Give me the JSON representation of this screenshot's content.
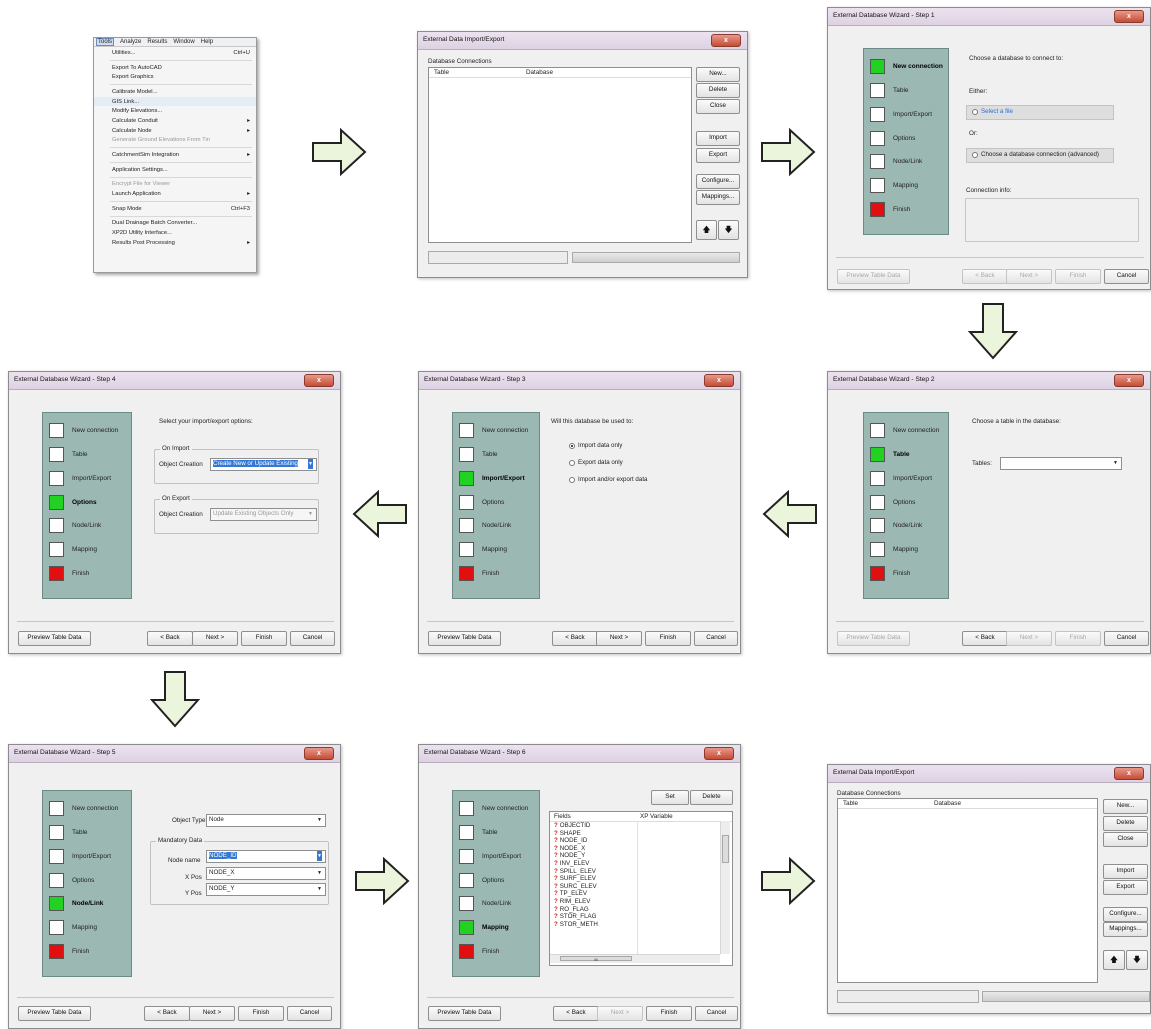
{
  "menu": {
    "bar": [
      "Tools",
      "Analyze",
      "Results",
      "Window",
      "Help"
    ],
    "items": [
      {
        "label": "Utilities...",
        "shortcut": "Ctrl+U"
      },
      {
        "sep": true
      },
      {
        "label": "Export To AutoCAD"
      },
      {
        "label": "Export Graphics"
      },
      {
        "sep": true
      },
      {
        "label": "Calibrate Model..."
      },
      {
        "label": "GIS Link...",
        "hot": true
      },
      {
        "label": "Modify Elevations..."
      },
      {
        "label": "Calculate Conduit",
        "sub": true
      },
      {
        "label": "Calculate Node",
        "sub": true
      },
      {
        "label": "Generate Ground Elevations From Tin",
        "disabled": true
      },
      {
        "sep": true
      },
      {
        "label": "CatchmentSim Integration",
        "sub": true
      },
      {
        "sep": true
      },
      {
        "label": "Application Settings..."
      },
      {
        "sep": true
      },
      {
        "label": "Encrypt File for Viewer",
        "disabled": true
      },
      {
        "label": "Launch Application",
        "sub": true
      },
      {
        "sep": true
      },
      {
        "label": "Snap Mode",
        "shortcut": "Ctrl+F3"
      },
      {
        "sep": true
      },
      {
        "label": "Dual Drainage Batch Converter..."
      },
      {
        "label": "XP2D Utility Interface..."
      },
      {
        "label": "Results Post Processing",
        "sub": true
      }
    ]
  },
  "import_export": {
    "title": "External Data Import/Export",
    "group_label": "Database Connections",
    "col_table": "Table",
    "col_database": "Database",
    "buttons": {
      "new": "New...",
      "delete": "Delete",
      "close": "Close",
      "import": "Import",
      "export": "Export",
      "configure": "Configure...",
      "mappings": "Mappings...",
      "up": "🡅",
      "down": "🡇"
    }
  },
  "wizard": {
    "steps": [
      "New connection",
      "Table",
      "Import/Export",
      "Options",
      "Node/Link",
      "Mapping",
      "Finish"
    ],
    "buttons": {
      "preview": "Preview Table Data",
      "back": "< Back",
      "next": "Next >",
      "finish": "Finish",
      "cancel": "Cancel"
    },
    "step1": {
      "title": "External Database Wizard - Step 1",
      "prompt": "Choose a database to connect to:",
      "either": "Either:",
      "select_file": "Select a file",
      "or": "Or:",
      "choose_conn": "Choose a database connection (advanced)",
      "conn_info": "Connection info:"
    },
    "step2": {
      "title": "External Database Wizard - Step 2",
      "prompt": "Choose a table in the database:",
      "tables_label": "Tables:"
    },
    "step3": {
      "title": "External Database Wizard - Step 3",
      "prompt": "Will this database be used to:",
      "opt1": "Import data only",
      "opt2": "Export data only",
      "opt3": "Import and/or export data"
    },
    "step4": {
      "title": "External Database Wizard - Step 4",
      "prompt": "Select your import/export options:",
      "on_import": "On Import",
      "on_export": "On Export",
      "object_creation": "Object Creation",
      "import_value": "Create New or Update Existing",
      "export_value": "Update Existing Objects Only"
    },
    "step5": {
      "title": "External Database Wizard - Step 5",
      "object_type_label": "Object Type",
      "object_type_value": "Node",
      "mandatory": "Mandatory Data",
      "node_name_label": "Node name",
      "node_name_value": "NODE_ID",
      "xpos_label": "X Pos",
      "xpos_value": "NODE_X",
      "ypos_label": "Y Pos",
      "ypos_value": "NODE_Y"
    },
    "step6": {
      "title": "External Database Wizard - Step 6",
      "set": "Set",
      "delete": "Delete",
      "col_fields": "Fields",
      "col_xp": "XP Variable",
      "fields": [
        "OBJECTID",
        "SHAPE",
        "NODE_ID",
        "NODE_X",
        "NODE_Y",
        "INV_ELEV",
        "SPILL_ELEV",
        "SURF_ELEV",
        "SURC_ELEV",
        "TP_ELEV",
        "RIM_ELEV",
        "RO_FLAG",
        "STOR_FLAG",
        "STOR_METH"
      ],
      "field_marker": "?",
      "scroll_thumb": "III"
    }
  },
  "colors": {
    "active_step": "#22d222",
    "finish_step": "#e10f0f",
    "panel": "#9cb8b3",
    "arrow_fill": "#eaf5dc"
  }
}
